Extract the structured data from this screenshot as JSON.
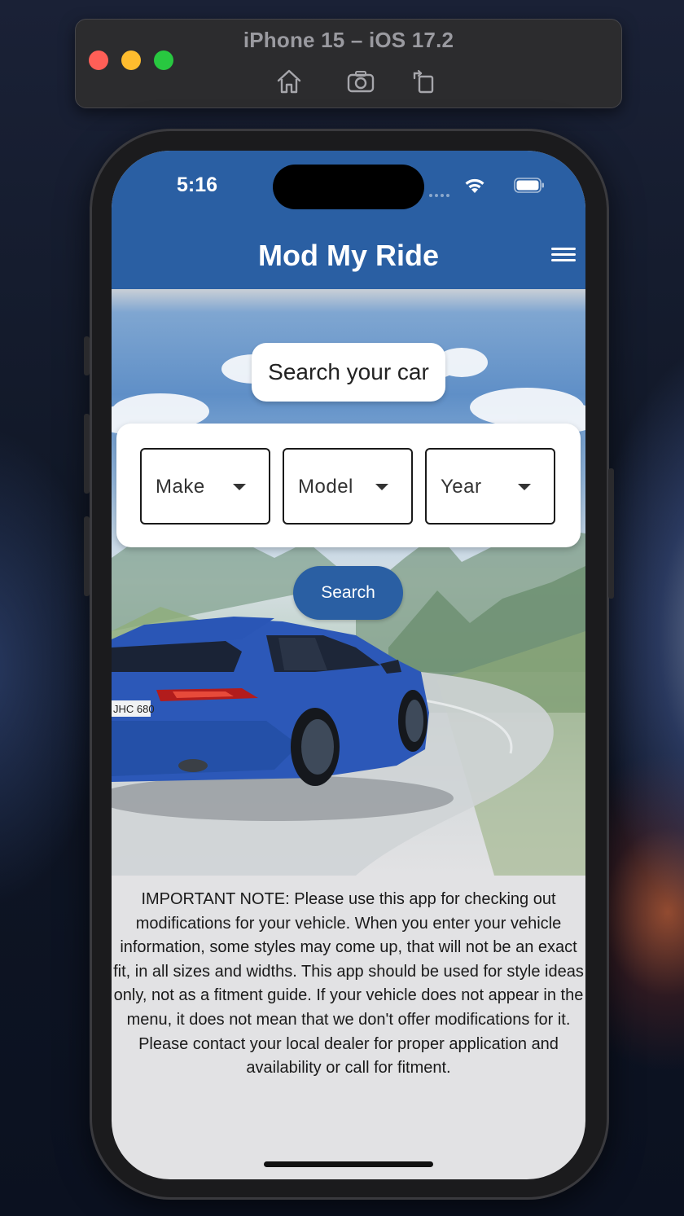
{
  "simulator": {
    "title": "iPhone 15 – iOS 17.2",
    "tools": [
      {
        "icon": "home-icon"
      },
      {
        "icon": "screenshot-icon"
      },
      {
        "icon": "rotate-icon"
      }
    ]
  },
  "status_bar": {
    "time": "5:16",
    "icons": [
      "cellular-dots-icon",
      "wifi-icon",
      "battery-icon"
    ]
  },
  "app_bar": {
    "title": "Mod My Ride",
    "menu_icon": "hamburger-menu-icon",
    "color": "#2a5fa3"
  },
  "search": {
    "heading": "Search your car",
    "dropdowns": [
      {
        "label": "Make"
      },
      {
        "label": "Model"
      },
      {
        "label": "Year"
      }
    ],
    "button_label": "Search"
  },
  "hero": {
    "car_plate": "JHC 680"
  },
  "note": "IMPORTANT NOTE: Please use this app for checking out modifications for your vehicle. When you enter your vehicle information, some styles may come up, that will not be an exact fit, in all sizes and widths. This app should be used for style ideas only, not as a fitment guide. If your vehicle does not appear in the menu, it does not mean that we don't offer modifications for it. Please contact your local dealer for proper application and availability or call for fitment."
}
